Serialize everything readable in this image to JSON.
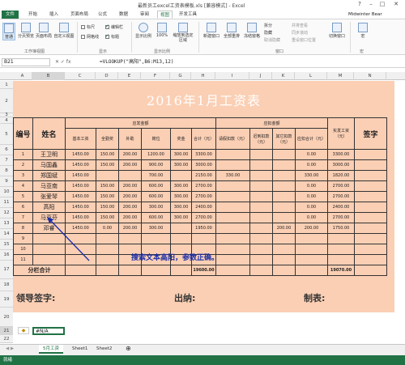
{
  "app": {
    "title": "最新员工excel工资表模板.xls [兼容模式] - Excel",
    "user": "Midwinter Bear"
  },
  "ribbon_tabs": [
    "文件",
    "开始",
    "插入",
    "页面布局",
    "公式",
    "数据",
    "审阅",
    "视图",
    "开发工具"
  ],
  "ribbon": {
    "view_group": {
      "normal": "普通",
      "page_break": "分页预览",
      "page_layout": "页面布局",
      "custom": "自定义视图",
      "group": "工作簿视图"
    },
    "show_group": {
      "ruler": "标尺",
      "formula_bar": "编辑栏",
      "gridlines": "网格线",
      "headings": "标题",
      "group": "显示"
    },
    "zoom_group": {
      "zoom": "显示比例",
      "zoom100": "100%",
      "zoom_sel": "缩放到选定区域",
      "group": "显示比例"
    },
    "window_group": {
      "new_window": "新建窗口",
      "arrange": "全部重排",
      "freeze": "冻结窗格",
      "split": "拆分",
      "hide": "隐藏",
      "unhide": "取消隐藏",
      "side": "并排查看",
      "sync": "同步滚动",
      "reset": "重设窗口位置",
      "switch": "切换窗口",
      "group": "窗口"
    },
    "macro_group": {
      "macro": "宏",
      "group": "宏"
    }
  },
  "formula_bar": {
    "name_box": "B21",
    "fx": "fx",
    "formula": "=VLOOKUP(\"高阳\",B6:M13,12)"
  },
  "columns": [
    "A",
    "B",
    "C",
    "D",
    "E",
    "F",
    "G",
    "H",
    "I",
    "J",
    "K",
    "L",
    "M",
    "N"
  ],
  "rows": [
    "1",
    "2",
    "3",
    "4",
    "5",
    "6",
    "7",
    "8",
    "9",
    "10",
    "11",
    "12",
    "13",
    "14",
    "15",
    "16",
    "17",
    "18",
    "19",
    "20",
    "21",
    "22"
  ],
  "sheet": {
    "title": "2016年1月工资表",
    "hdr": {
      "no": "编号",
      "name": "姓名",
      "pay": "应发金额",
      "deduct": "应扣金额",
      "net": "实发工资（元）",
      "sign": "签字"
    },
    "sub": [
      "基本工资",
      "全勤奖",
      "补助",
      "岗位",
      "奖金",
      "合计（元）",
      "请假扣款（元）",
      "迟到扣款（元）",
      "其它扣款（元）",
      "应扣合计（元）"
    ],
    "rows": [
      [
        "1",
        "王卫明",
        "1450.00",
        "150.00",
        "200.00",
        "1200.00",
        "300.00",
        "3300.00",
        "",
        "",
        "",
        "0.00",
        "3300.00"
      ],
      [
        "2",
        "马国鑫",
        "1450.00",
        "150.00",
        "200.00",
        "900.00",
        "300.00",
        "3000.00",
        "",
        "",
        "",
        "0.00",
        "3000.00"
      ],
      [
        "3",
        "郑国斌",
        "1450.00",
        "",
        "",
        "700.00",
        "",
        "2150.00",
        "330.00",
        "",
        "",
        "330.00",
        "1820.00"
      ],
      [
        "4",
        "马亚南",
        "1450.00",
        "150.00",
        "200.00",
        "600.00",
        "300.00",
        "2700.00",
        "",
        "",
        "",
        "0.00",
        "2700.00"
      ],
      [
        "5",
        "张爱琴",
        "1450.00",
        "150.00",
        "200.00",
        "600.00",
        "300.00",
        "2700.00",
        "",
        "",
        "",
        "0.00",
        "2700.00"
      ],
      [
        "6",
        "高阳",
        "1450.00",
        "150.00",
        "200.00",
        "300.00",
        "300.00",
        "2400.00",
        "",
        "",
        "",
        "0.00",
        "2400.00"
      ],
      [
        "7",
        "马亚芬",
        "1450.00",
        "150.00",
        "200.00",
        "600.00",
        "300.00",
        "2700.00",
        "",
        "",
        "",
        "0.00",
        "2700.00"
      ],
      [
        "8",
        "邓睿",
        "1450.00",
        "0.00",
        "200.00",
        "300.00",
        "",
        "1950.00",
        "",
        "",
        "200.00",
        "200.00",
        "1750.00"
      ],
      [
        "9",
        "",
        "",
        "",
        "",
        "",
        "",
        "",
        "",
        "",
        "",
        "",
        ""
      ],
      [
        "10",
        "",
        "",
        "",
        "",
        "",
        "",
        "",
        "",
        "",
        "",
        "",
        ""
      ],
      [
        "11",
        "",
        "",
        "",
        "",
        "",
        "",
        "",
        "",
        "",
        "",
        "",
        ""
      ]
    ],
    "sum_label": "分栏合计",
    "sum_total": "19600.00",
    "sum_net": "19070.00",
    "sign_leader": "领导签字:",
    "sign_cashier": "出纳:",
    "sign_maker": "制表:",
    "cell_b21": "#N/A"
  },
  "annotation": "搜索文本高阳，参数正确。",
  "sheet_tabs": [
    "5月工资",
    "Sheet1",
    "Sheet2"
  ],
  "status": "就绪"
}
